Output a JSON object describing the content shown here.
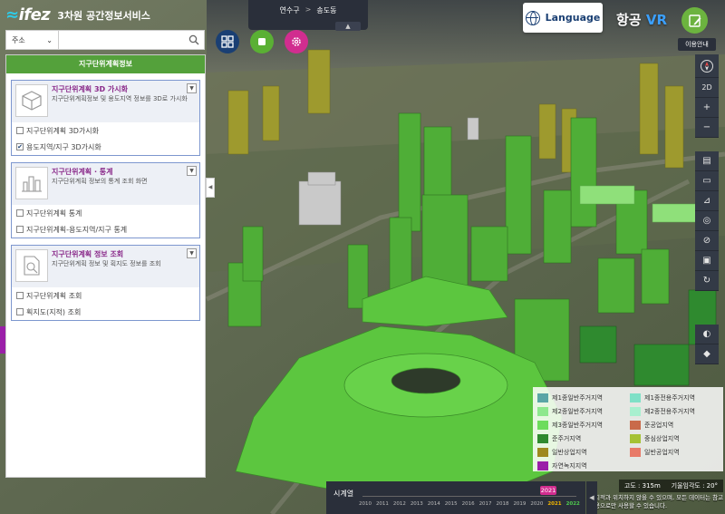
{
  "header": {
    "logo_text": "ifez",
    "service_title": "3차원 공간정보서비스",
    "location": {
      "district": "연수구",
      "dong": "송도동",
      "separator": ">"
    },
    "location_toggle": "▲",
    "language_label": "Language",
    "vr_prefix": "항공",
    "vr_suffix": "VR",
    "guide_label": "이용안내"
  },
  "search": {
    "select_value": "주소",
    "input_value": "",
    "input_placeholder": ""
  },
  "tools": [
    {
      "name": "grid-menu",
      "icon": "grid-icon",
      "color": "#1a3f73"
    },
    {
      "name": "record",
      "icon": "stop-square-icon",
      "color": "#5ab034"
    },
    {
      "name": "settings",
      "icon": "gear-icon",
      "color": "#d12d8f"
    }
  ],
  "panel": {
    "title": "지구단위계획정보",
    "collapse_glyph": "◀",
    "cards": [
      {
        "title": "지구단위계획 3D 가시화",
        "description": "지구단위계획정보 및 용도지역 정보를 3D로 가시화",
        "icon": "cube-icon",
        "options": [
          {
            "label": "지구단위계획 3D가시화",
            "checked": false
          },
          {
            "label": "용도지역/지구 3D가시화",
            "checked": true
          }
        ]
      },
      {
        "title": "지구단위계획 · 통계",
        "description": "지구단위계획 정보의 통계 조회 화면",
        "icon": "city-chart-icon",
        "options": [
          {
            "label": "지구단위계획 통계",
            "checked": false
          },
          {
            "label": "지구단위계획-용도지역/지구 통계",
            "checked": false
          }
        ]
      },
      {
        "title": "지구단위계획 정보 조회",
        "description": "지구단위계획 정보 및 획지도 정보를 조회",
        "icon": "document-search-icon",
        "options": [
          {
            "label": "지구단위계획 조회",
            "checked": false
          },
          {
            "label": "획지도(지적) 조회",
            "checked": false
          }
        ]
      }
    ]
  },
  "right_toolbar": {
    "group1": [
      "compass-icon",
      "2D",
      "+",
      "−"
    ],
    "group2": [
      "layers-icon",
      "measure-icon",
      "chart-icon",
      "capture-icon",
      "link-icon",
      "save-icon",
      "refresh-icon"
    ],
    "group3": [
      "contrast-icon",
      "shadow-icon"
    ]
  },
  "legend": [
    {
      "label": "제1종일반주거지역",
      "color": "#5aa6a6"
    },
    {
      "label": "제1종전용주거지역",
      "color": "#7fe0c7"
    },
    {
      "label": "제2종일반주거지역",
      "color": "#8ee88e"
    },
    {
      "label": "제2종전용주거지역",
      "color": "#a8f0cf"
    },
    {
      "label": "제3종일반주거지역",
      "color": "#6ddc5c"
    },
    {
      "label": "준공업지역",
      "color": "#c96a4a"
    },
    {
      "label": "준주거지역",
      "color": "#2f8a2f"
    },
    {
      "label": "중심상업지역",
      "color": "#a5c234"
    },
    {
      "label": "일반상업지역",
      "color": "#9e8a1e"
    },
    {
      "label": "일반공업지역",
      "color": "#e87a68"
    },
    {
      "label": "자연녹지지역",
      "color": "#9a1fa8"
    }
  ],
  "status": {
    "altitude": "고도 : 315m",
    "tilt": "기울임각도 : 20°"
  },
  "disclaimer": "지적과 위치하지 않을 수 있으며, 모든 데이터는 참고용으로만 사용할 수 있습니다.",
  "timeline": {
    "title": "시계열",
    "years": [
      "2010",
      "2011",
      "2012",
      "2013",
      "2014",
      "2015",
      "2016",
      "2017",
      "2018",
      "2019",
      "2020",
      "2021",
      "2022"
    ],
    "current_year": "2021",
    "next_year": "2022",
    "play_glyph": "◀"
  }
}
